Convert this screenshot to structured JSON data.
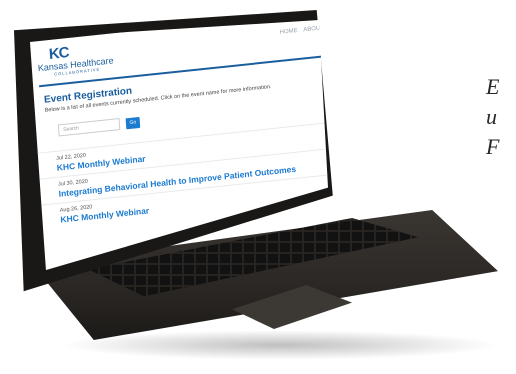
{
  "side_text": [
    "E",
    "u",
    "F"
  ],
  "site": {
    "logo_mark": "KC",
    "logo_name": "Kansas Healthcare",
    "logo_sub": "COLLABORATIVE",
    "nav": [
      "HOME",
      "ABOUT US"
    ]
  },
  "page": {
    "title": "Event Registration",
    "intro": "Below is a list of all events currently scheduled. Click on the event name for more information."
  },
  "search": {
    "placeholder": "Search",
    "button_label": "Go"
  },
  "events": [
    {
      "date": "Jul 22, 2020",
      "title": "KHC Monthly Webinar"
    },
    {
      "date": "Jul 30, 2020",
      "title": "Integrating Behavioral Health to Improve Patient Outcomes"
    },
    {
      "date": "Aug 26, 2020",
      "title": "KHC Monthly Webinar"
    }
  ],
  "colors": {
    "brand": "#1b5e9e",
    "link": "#1b7bd0"
  }
}
